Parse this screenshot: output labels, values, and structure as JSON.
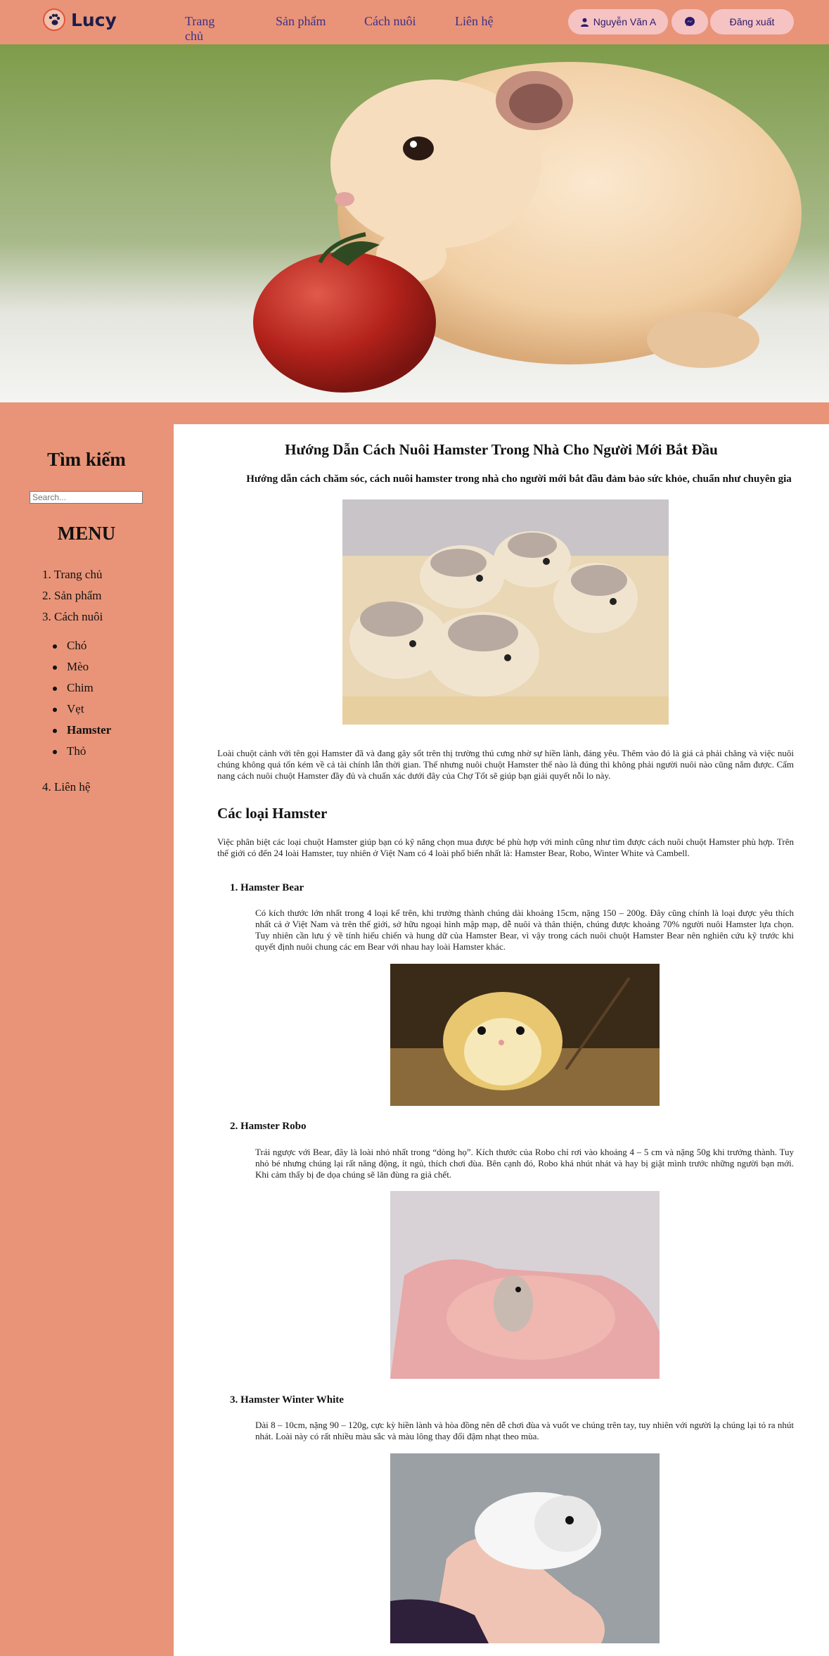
{
  "header": {
    "logo_text": "Lucy",
    "nav": [
      "Trang chủ",
      "Sản phẩm",
      "Cách nuôi",
      "Liên hệ"
    ],
    "user_label": "Nguyễn Văn A",
    "logout_label": "Đăng xuất"
  },
  "sidebar": {
    "search_title": "Tìm kiếm",
    "search_placeholder": "Search...",
    "menu_title": "MENU",
    "menu": [
      "1. Trang chủ",
      "2. Sản phẩm",
      "3. Cách nuôi"
    ],
    "sub_menu": [
      "Chó",
      "Mèo",
      "Chim",
      "Vẹt",
      "Hamster",
      "Thỏ"
    ],
    "menu_last": "4. Liên hệ"
  },
  "article": {
    "title": "Hướng Dẫn Cách Nuôi Hamster Trong Nhà Cho Người Mới Bắt Đầu",
    "subtitle": "Hướng dẫn cách chăm sóc, cách nuôi hamster trong nhà cho người mới bắt đầu đảm bảo sức khỏe, chuẩn như chuyên gia",
    "intro": "Loài chuột cảnh với tên gọi Hamster đã và đang gây sốt trên thị trường thú cưng nhờ sự hiền lành, đáng yêu. Thêm vào đó là giá cả phải chăng và việc nuôi chúng không quá tốn kém về cả tài chính lẫn thời gian. Thế nhưng nuôi chuột Hamster thế nào là đúng thì không phải người nuôi nào cũng nắm được. Cẩm nang cách nuôi chuột Hamster đầy đủ và chuẩn xác dưới đây của Chợ Tốt sẽ giúp bạn giải quyết nỗi lo này.",
    "types_heading": "Các loại Hamster",
    "types_intro": "Việc phân biệt các loại chuột Hamster giúp bạn có kỹ năng chọn mua được bé phù hợp với mình cũng như tìm được cách nuôi chuột Hamster phù hợp. Trên thế giới có đến 24 loài Hamster, tuy nhiên ở Việt Nam có 4 loài phổ biến nhất là: Hamster Bear, Robo, Winter White và Cambell.",
    "types": [
      {
        "heading": "1. Hamster Bear",
        "text": "Có kích thước lớn nhất trong 4 loại kể trên, khi trưởng thành chúng dài khoảng 15cm, nặng 150 – 200g. Đây cũng chính là loại được yêu thích nhất cả ở Việt Nam và trên thế giới, sở hữu ngoại hình mập mạp, dễ nuôi và thân thiện, chúng được khoảng 70% người nuôi Hamster lựa chọn. Tuy nhiên cần lưu ý về tính hiếu chiến và hung dữ của Hamster Bear, vì vậy trong cách nuôi chuột Hamster Bear nên nghiên cứu kỹ trước khi quyết định nuôi chung các em Bear với nhau hay loài Hamster khác."
      },
      {
        "heading": "2. Hamster Robo",
        "text": "Trái ngược với Bear, đây là loài nhỏ nhất trong “dòng họ”. Kích thước của Robo chỉ rơi vào khoảng 4 – 5 cm và nặng 50g khi trưởng thành. Tuy nhỏ bé nhưng chúng lại rất năng động, ít ngủ, thích chơi đùa. Bên cạnh đó, Robo khá nhút nhát và hay bị giật mình trước những người bạn mới. Khi cảm thấy bị đe dọa chúng sẽ lăn đùng ra giả chết."
      },
      {
        "heading": "3. Hamster Winter White",
        "text": "Dài 8 – 10cm, nặng 90 – 120g, cực kỳ hiền lành và hòa đồng nên dễ chơi đùa và vuốt ve chúng trên tay, tuy nhiên với người lạ chúng lại tỏ ra nhút nhát. Loài này có rất nhiều màu sắc và màu lông thay đổi đậm nhạt theo mùa."
      }
    ]
  },
  "colors": {
    "background": "#e99478",
    "content_bg": "#ffffff",
    "button_bg": "#f6c3c3",
    "nav_text": "#3d2f8a"
  }
}
